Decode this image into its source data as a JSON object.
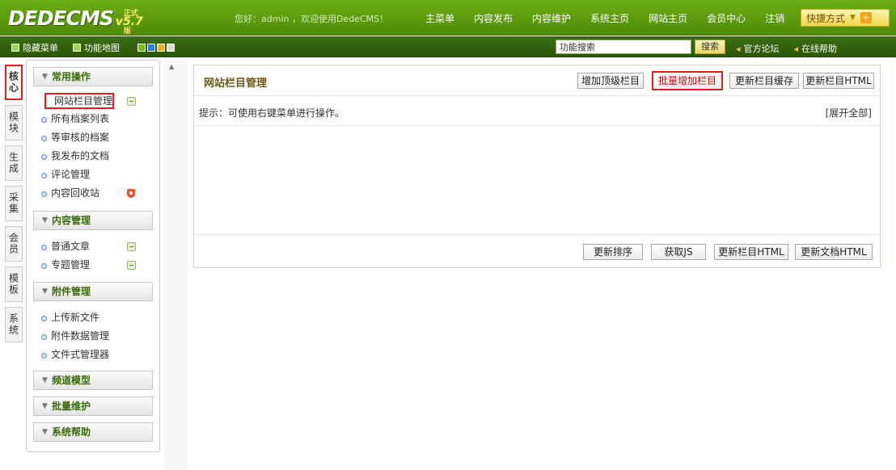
{
  "header": {
    "logo_main": "DEDECMS",
    "logo_version": "v5.7",
    "logo_tag": "正式版",
    "welcome": "您好：admin ，欢迎使用DedeCMS！",
    "nav": [
      "主菜单",
      "内容发布",
      "内容维护",
      "系统主页",
      "网站主页",
      "会员中心",
      "注销"
    ],
    "shortcut_label": "快捷方式",
    "brand_color": "#4f8b09"
  },
  "subbar": {
    "hide_menu": "隐藏菜单",
    "function_map": "功能地图",
    "palette": [
      "#79c020",
      "#2f7de1",
      "#e9b319",
      "#d9d9d9"
    ],
    "search_value": "功能搜索",
    "search_button": "搜索",
    "links": [
      "官方论坛",
      "在线帮助"
    ]
  },
  "vtabs": [
    {
      "label": "核心",
      "active": true
    },
    {
      "label": "模块",
      "active": false
    },
    {
      "label": "生成",
      "active": false
    },
    {
      "label": "采集",
      "active": false
    },
    {
      "label": "会员",
      "active": false
    },
    {
      "label": "模板",
      "active": false
    },
    {
      "label": "系统",
      "active": false
    }
  ],
  "menu": {
    "groups": [
      {
        "title": "常用操作"
      },
      {
        "title": "内容管理"
      },
      {
        "title": "附件管理"
      },
      {
        "title": "频道模型"
      },
      {
        "title": "批量维护"
      },
      {
        "title": "系统帮助"
      }
    ],
    "items": [
      "网站栏目管理",
      "所有档案列表",
      "等审核的档案",
      "我发布的文档",
      "评论管理",
      "内容回收站",
      "普通文章",
      "专题管理",
      "上传新文件",
      "附件数据管理",
      "文件式管理器"
    ]
  },
  "panel": {
    "title": "网站栏目管理",
    "buttons": [
      "增加顶级栏目",
      "批量增加栏目",
      "更新栏目缓存",
      "更新栏目HTML"
    ],
    "tip": "提示：可使用右键菜单进行操作。",
    "expand_all": "[展开全部]",
    "footer_buttons": [
      "更新排序",
      "获取JS",
      "更新栏目HTML",
      "更新文档HTML"
    ]
  }
}
